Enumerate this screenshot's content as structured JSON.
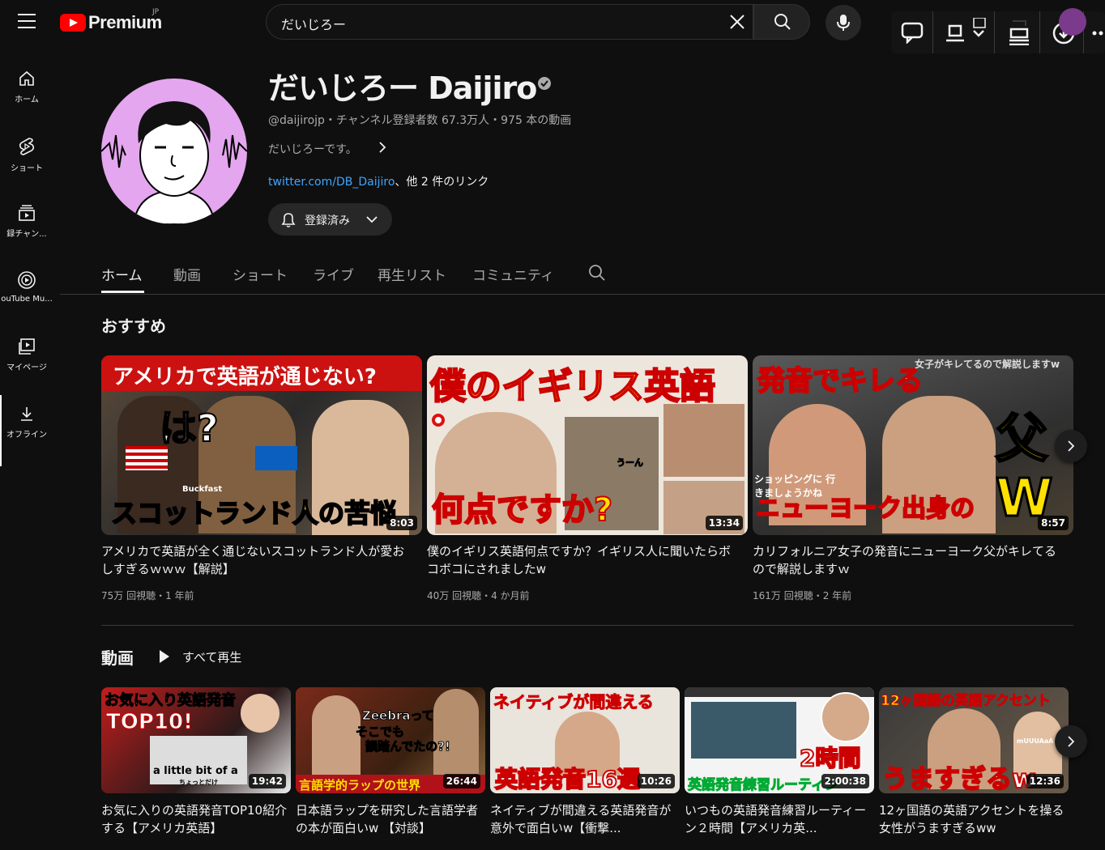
{
  "app": {
    "logo_text": "Premium",
    "region": "JP"
  },
  "search": {
    "value": "だいじろー"
  },
  "sidebar": {
    "items": [
      {
        "label": "ホーム"
      },
      {
        "label": "ショート"
      },
      {
        "label": "録チャン..."
      },
      {
        "label": "ouTube Mu..."
      },
      {
        "label": "マイページ"
      },
      {
        "label": "オフライン"
      }
    ]
  },
  "channel": {
    "name": "だいじろー Daijiro",
    "meta": "@daijirojp・チャンネル登録者数 67.3万人・975 本の動画",
    "description": "だいじろーです。",
    "link_text": "twitter.com/DB_Daijiro",
    "link_suffix": "、他 2 件のリンク",
    "subscribe_label": "登録済み"
  },
  "tabs": [
    "ホーム",
    "動画",
    "ショート",
    "ライブ",
    "再生リスト",
    "コミュニティ"
  ],
  "recommended": {
    "title": "おすすめ",
    "videos": [
      {
        "thumb_top": "アメリカで英語が通じない?",
        "thumb_mid": "は?",
        "thumb_bottom": "スコットランド人の苦悩",
        "thumb_small": "Buckfast",
        "duration": "8:03",
        "title": "アメリカで英語が全く通じないスコットランド人が愛おしすぎるｗｗｗ【解説】",
        "meta": "75万 回視聴・1 年前"
      },
      {
        "thumb_top": "僕のイギリス英語",
        "thumb_bottom": "何点ですか?",
        "thumb_small": "うーん",
        "duration": "13:34",
        "title": "僕のイギリス英語何点ですか？イギリス人に聞いたらボコボコにされましたw",
        "meta": "40万 回視聴・4 か月前"
      },
      {
        "thumb_top": "発音でキレる",
        "thumb_corner": "女子がキレてるので解説しますw",
        "thumb_right": "父",
        "thumb_w": "W",
        "thumb_small": "ショッピングに 行きましょうかね",
        "thumb_bottom": "ニューヨーク出身の",
        "duration": "8:57",
        "title": "カリフォルニア女子の発音にニューヨーク父がキレてるので解説しますｗ",
        "meta": "161万 回視聴・2 年前"
      }
    ]
  },
  "videos_section": {
    "title": "動画",
    "play_all": "すべて再生",
    "videos": [
      {
        "thumb_top": "お気に入り英語発音",
        "thumb_mid": "TOP10!",
        "thumb_bottom": "a little bit of a",
        "thumb_sub": "ちょっとだけ",
        "duration": "19:42",
        "title": "お気に入りの英語発音TOP10紹介する【アメリカ英語】"
      },
      {
        "thumb_top": "Zeebraって",
        "thumb_mid": "そこでも",
        "thumb_mid2": "韻踏んでたの?!",
        "thumb_bottom": "言語学的ラップの世界",
        "duration": "26:44",
        "title": "日本語ラップを研究した言語学者の本が面白いw 【対談】"
      },
      {
        "thumb_top": "ネイティブが間違える",
        "thumb_bottom": "英語発音16選",
        "duration": "10:26",
        "title": "ネイティブが間違える英語発音が意外で面白いw【衝撃..."
      },
      {
        "thumb_mid": "2時間",
        "thumb_bottom": "英語発音練習ルーティン",
        "duration": "2:00:38",
        "title": "いつもの英語発音練習ルーティーン２時間【アメリカ英..."
      },
      {
        "thumb_top": "12ヶ国語の英語アクセント",
        "thumb_bottom": "うますぎるw",
        "thumb_small": "mUUUAaA",
        "duration": "12:36",
        "title": "12ヶ国語の英語アクセントを操る女性がうますぎるww"
      }
    ]
  },
  "colors": {
    "accent": "#ff0000",
    "link": "#3ea6ff",
    "background": "#0f0f0f",
    "avatar_bg": "#e4a6ee"
  },
  "icons": [
    "menu-icon",
    "youtube-logo-icon",
    "clear-icon",
    "search-icon",
    "mic-icon",
    "chat-icon",
    "screenshot-icon",
    "reading-list-icon",
    "download-icon",
    "more-icon",
    "home-icon",
    "shorts-icon",
    "subscriptions-icon",
    "youtube-music-icon",
    "library-icon",
    "offline-icon",
    "bell-icon",
    "chevron-down-icon",
    "chevron-right-icon",
    "play-icon"
  ]
}
